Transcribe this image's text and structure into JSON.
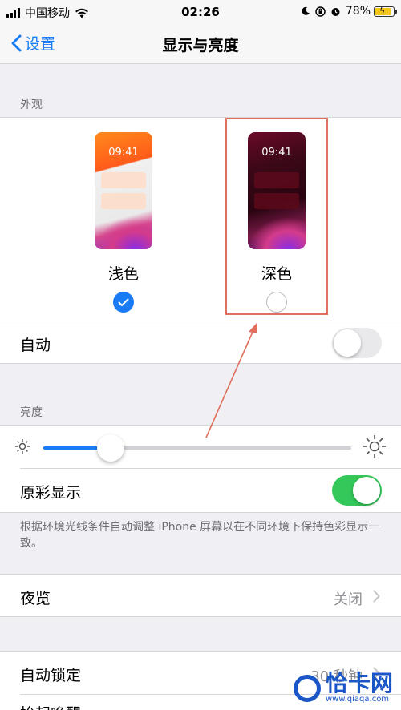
{
  "status_bar": {
    "carrier": "中国移动",
    "time": "02:26",
    "battery": "78%"
  },
  "nav": {
    "back_label": "设置",
    "title": "显示与亮度"
  },
  "appearance": {
    "header": "外观",
    "light": {
      "preview_time": "09:41",
      "label": "浅色",
      "selected": true
    },
    "dark": {
      "preview_time": "09:41",
      "label": "深色",
      "selected": false
    },
    "auto_label": "自动",
    "auto_on": false
  },
  "brightness": {
    "header": "亮度",
    "level": 0.22,
    "true_tone_label": "原彩显示",
    "true_tone_on": true,
    "footnote": "根据环境光线条件自动调整 iPhone 屏幕以在不同环境下保持色彩显示一致。"
  },
  "night_shift": {
    "label": "夜览",
    "value": "关闭"
  },
  "auto_lock": {
    "label": "自动锁定",
    "value": "30 秒钟"
  },
  "raise_to_wake": {
    "label": "抬起唤醒"
  },
  "watermark": {
    "brand": "恰卡网",
    "url": "www.qiaqa.com"
  },
  "colors": {
    "accent": "#1a7cf5",
    "toggle_on": "#34c759",
    "highlight": "#e0705c"
  }
}
